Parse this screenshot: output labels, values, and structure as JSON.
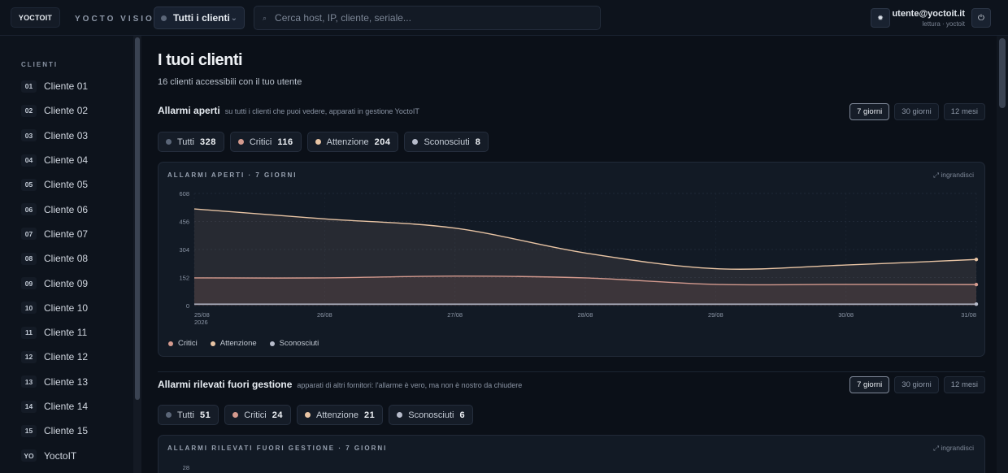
{
  "topbar": {
    "logo": "YOCTOIT",
    "brand": "YOCTO VISION",
    "client_select": "Tutti i clienti",
    "search_placeholder": "Cerca host, IP, cliente, seriale...",
    "user_email": "utente@yoctoit.it",
    "user_role": "lettura · yoctoit"
  },
  "sidebar": {
    "section_label": "CLIENTI",
    "items": [
      {
        "code": "01",
        "label": "Cliente 01"
      },
      {
        "code": "02",
        "label": "Cliente 02"
      },
      {
        "code": "03",
        "label": "Cliente 03"
      },
      {
        "code": "04",
        "label": "Cliente 04"
      },
      {
        "code": "05",
        "label": "Cliente 05"
      },
      {
        "code": "06",
        "label": "Cliente 06"
      },
      {
        "code": "07",
        "label": "Cliente 07"
      },
      {
        "code": "08",
        "label": "Cliente 08"
      },
      {
        "code": "09",
        "label": "Cliente 09"
      },
      {
        "code": "10",
        "label": "Cliente 10"
      },
      {
        "code": "11",
        "label": "Cliente 11"
      },
      {
        "code": "12",
        "label": "Cliente 12"
      },
      {
        "code": "13",
        "label": "Cliente 13"
      },
      {
        "code": "14",
        "label": "Cliente 14"
      },
      {
        "code": "15",
        "label": "Cliente 15"
      },
      {
        "code": "YO",
        "label": "YoctoIT"
      }
    ]
  },
  "main": {
    "title": "I tuoi clienti",
    "subtitle": "16 clienti accessibili con il tuo utente",
    "ranges": [
      "7 giorni",
      "30 giorni",
      "12 mesi"
    ],
    "open_alarms": {
      "title": "Allarmi aperti",
      "subtitle": "su tutti i clienti che puoi vedere, apparati in gestione YoctoIT",
      "filters": [
        {
          "label": "Tutti",
          "count": "328"
        },
        {
          "label": "Critici",
          "count": "116"
        },
        {
          "label": "Attenzione",
          "count": "204"
        },
        {
          "label": "Sconosciuti",
          "count": "8"
        }
      ],
      "card_label": "ALLARMI APERTI · 7 GIORNI",
      "expand": "⤢ ingrandisci",
      "legend": [
        "Critici",
        "Attenzione",
        "Sconosciuti"
      ]
    },
    "external_alarms": {
      "title": "Allarmi rilevati fuori gestione",
      "subtitle": "apparati di altri fornitori: l'allarme è vero, ma non è nostro da chiudere",
      "filters": [
        {
          "label": "Tutti",
          "count": "51"
        },
        {
          "label": "Critici",
          "count": "24"
        },
        {
          "label": "Attenzione",
          "count": "21"
        },
        {
          "label": "Sconosciuti",
          "count": "6"
        }
      ],
      "card_label": "ALLARMI RILEVATI FUORI GESTIONE · 7 GIORNI",
      "expand": "⤢ ingrandisci",
      "y_top_tick": "28"
    }
  },
  "colors": {
    "tutti": "#5b6678",
    "critici": "#d49a8e",
    "attenzione": "#e8c4a4",
    "sconosciuti": "#b7bccb"
  },
  "chart_data": {
    "type": "area",
    "title": "ALLARMI APERTI · 7 GIORNI",
    "x": [
      "25/08 2026",
      "26/08",
      "27/08",
      "28/08",
      "29/08",
      "30/08",
      "31/08"
    ],
    "ylim": [
      0,
      608
    ],
    "yticks": [
      "0",
      "152",
      "304",
      "456",
      "608"
    ],
    "grid": true,
    "legend_position": "bottom-left",
    "series": [
      {
        "name": "Attenzione",
        "values": [
          524,
          470,
          420,
          285,
          200,
          220,
          250
        ]
      },
      {
        "name": "Critici",
        "values": [
          150,
          150,
          160,
          150,
          115,
          115,
          114
        ]
      },
      {
        "name": "Sconosciuti",
        "values": [
          8,
          8,
          8,
          8,
          8,
          8,
          8
        ]
      }
    ]
  }
}
